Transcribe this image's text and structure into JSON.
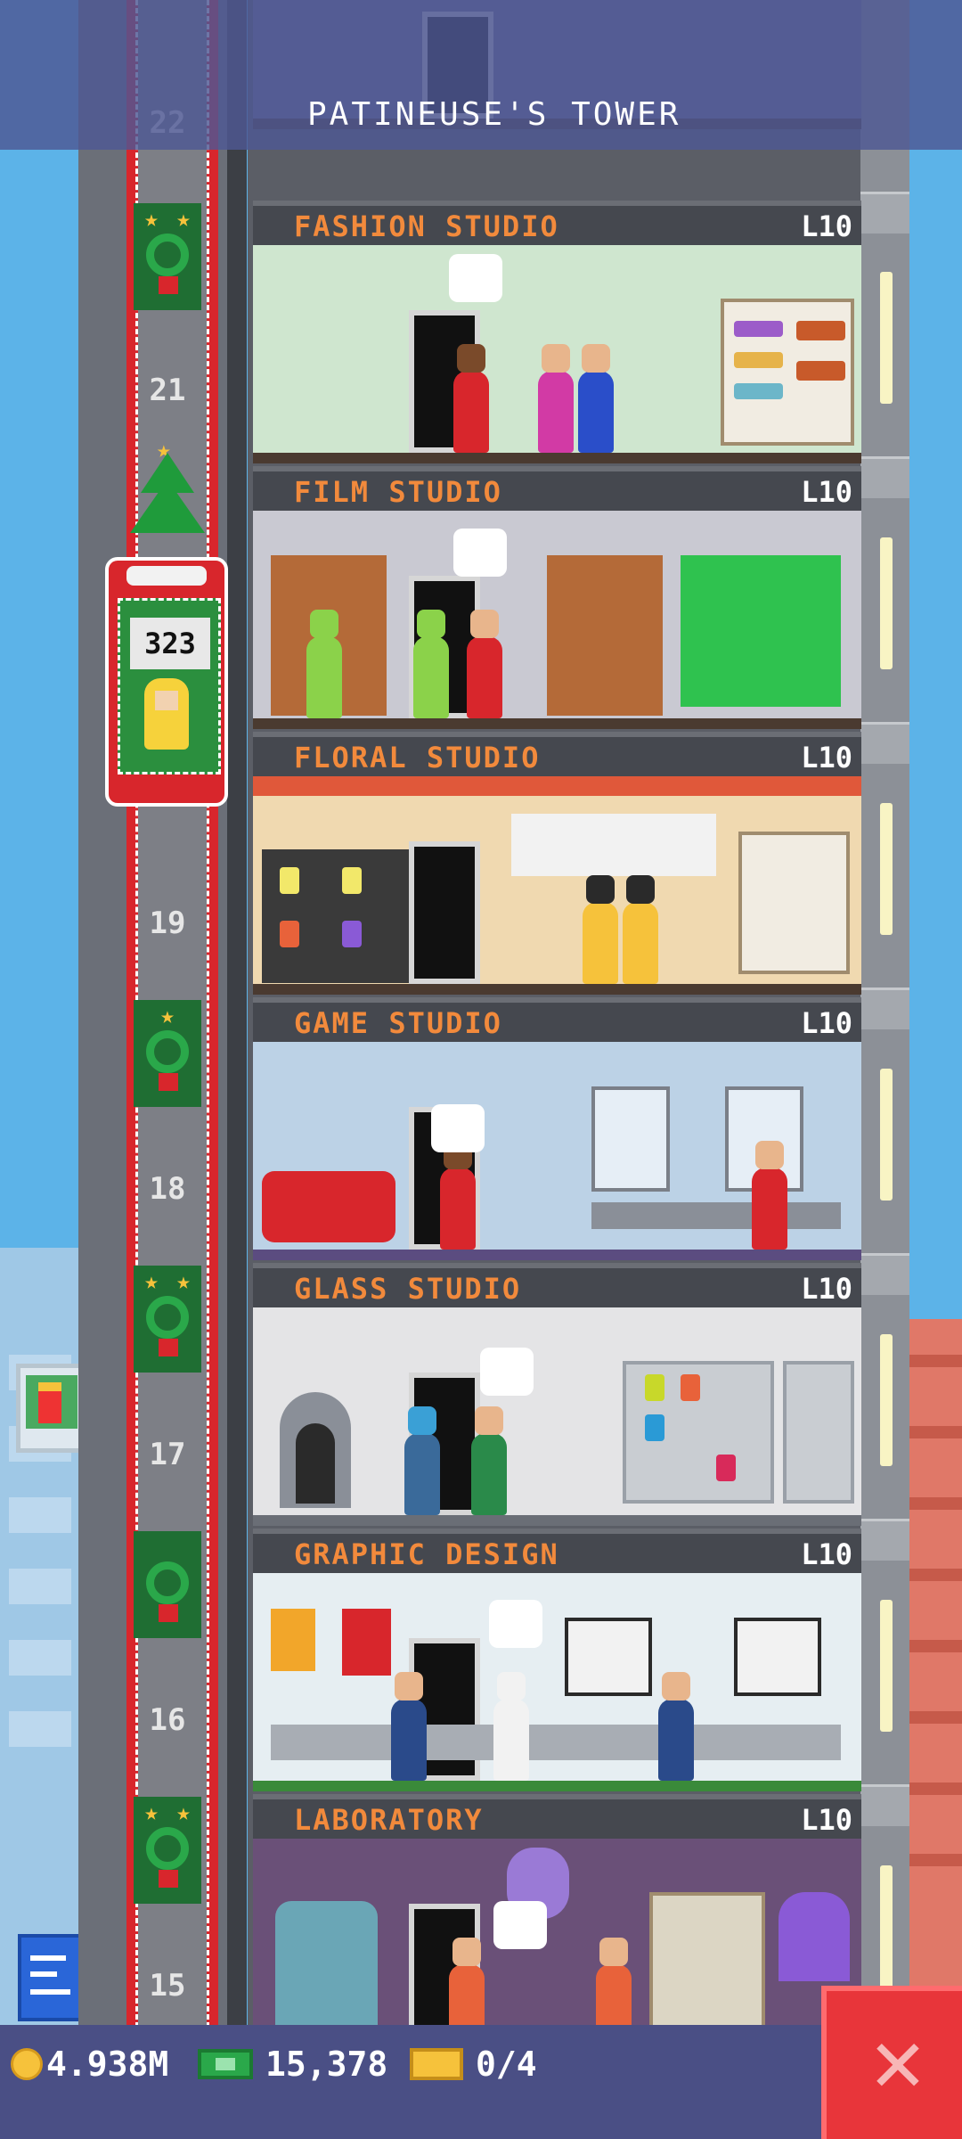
{
  "tower": {
    "title": "PATINEUSE'S TOWER"
  },
  "elevator": {
    "display": "323"
  },
  "shaft": {
    "floor_numbers": [
      "22",
      "21",
      "19",
      "18",
      "17",
      "16",
      "15"
    ]
  },
  "floors": [
    {
      "name": "FASHION STUDIO",
      "level": "L10"
    },
    {
      "name": "FILM STUDIO",
      "level": "L10"
    },
    {
      "name": "FLORAL STUDIO",
      "level": "L10"
    },
    {
      "name": "GAME STUDIO",
      "level": "L10"
    },
    {
      "name": "GLASS STUDIO",
      "level": "L10"
    },
    {
      "name": "GRAPHIC DESIGN",
      "level": "L10"
    },
    {
      "name": "LABORATORY",
      "level": "L10"
    }
  ],
  "resources": {
    "coins": "4.938M",
    "bux": "15,378",
    "tickets": "0/4"
  },
  "icons": {
    "coin": "coin-icon",
    "bux": "tower-bux-icon",
    "ticket": "golden-ticket-icon",
    "close": "close-icon"
  },
  "colors": {
    "top_bar": "#4e5894",
    "floor_label": "#f28a3c",
    "close_button": "#e8353a"
  }
}
